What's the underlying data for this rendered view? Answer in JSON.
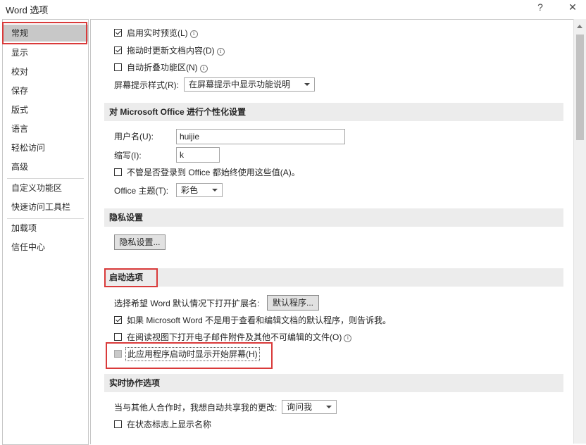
{
  "window": {
    "title": "Word 选项",
    "help": "?",
    "close": "✕"
  },
  "sidebar": {
    "items": [
      {
        "label": "常规"
      },
      {
        "label": "显示"
      },
      {
        "label": "校对"
      },
      {
        "label": "保存"
      },
      {
        "label": "版式"
      },
      {
        "label": "语言"
      },
      {
        "label": "轻松访问"
      },
      {
        "label": "高级"
      },
      {
        "label": "自定义功能区"
      },
      {
        "label": "快速访问工具栏"
      },
      {
        "label": "加载项"
      },
      {
        "label": "信任中心"
      }
    ],
    "selected": "常规"
  },
  "ui_options": {
    "live_preview": {
      "label": "启用实时预览(L)",
      "checked": true
    },
    "update_drag": {
      "label": "拖动时更新文档内容(D)",
      "checked": true
    },
    "collapse_ribbon": {
      "label": "自动折叠功能区(N)",
      "checked": false
    },
    "screentip_label": "屏幕提示样式(R):",
    "screentip_value": "在屏幕提示中显示功能说明"
  },
  "personalize": {
    "header": "对 Microsoft Office 进行个性化设置",
    "username_label": "用户名(U):",
    "username_value": "huijie",
    "initials_label": "缩写(I):",
    "initials_value": "k",
    "always_use": {
      "label": "不管是否登录到 Office 都始终使用这些值(A)。",
      "checked": false
    },
    "theme_label": "Office 主题(T):",
    "theme_value": "彩色"
  },
  "privacy": {
    "header": "隐私设置",
    "button": "隐私设置..."
  },
  "startup": {
    "header": "启动选项",
    "ext_label": "选择希望 Word 默认情况下打开扩展名:",
    "default_programs_button": "默认程序...",
    "tell_me": {
      "label": "如果 Microsoft Word 不是用于查看和编辑文档的默认程序，则告诉我。",
      "checked": true
    },
    "open_attachments": {
      "label": "在阅读视图下打开电子邮件附件及其他不可编辑的文件(O)",
      "checked": false
    },
    "show_start_screen": {
      "label": "此应用程序启动时显示开始屏幕(H)",
      "checked": false,
      "disabled": true
    }
  },
  "coauthoring": {
    "header": "实时协作选项",
    "share_label": "当与其他人合作时，我想自动共享我的更改:",
    "share_value": "询问我",
    "show_names": {
      "label": "在状态标志上显示名称",
      "checked": false
    }
  },
  "colors": {
    "highlight_red": "#d93a3a",
    "section_bg": "#ececec",
    "selected_bg": "#c8c8c8"
  },
  "icons": {
    "info": "info-icon",
    "dropdown": "chevron-down-icon"
  }
}
